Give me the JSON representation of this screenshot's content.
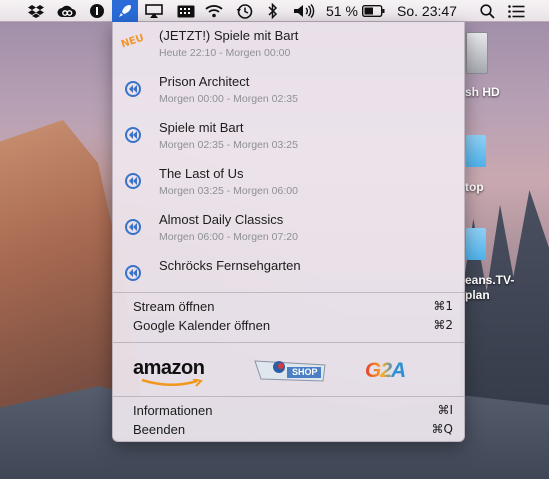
{
  "menubar": {
    "battery_percent": "51 %",
    "clock": "So. 23:47",
    "icons": [
      "dropbox-icon",
      "creative-cloud-icon",
      "info-circle-icon",
      "rocket-app-icon",
      "airplay-icon",
      "keyboard-icon",
      "wifi-icon",
      "time-machine-icon",
      "bluetooth-icon",
      "volume-icon",
      "battery-icon",
      "spotlight-search-icon",
      "notification-center-icon"
    ]
  },
  "desktop": {
    "disk_label": "sh HD",
    "folder1_label": "top",
    "folder2_label_line1": "eans.TV-",
    "folder2_label_line2": "plan"
  },
  "menu": {
    "badge_new": "NEU",
    "entries": [
      {
        "title": "(JETZT!) Spiele mit Bart",
        "time": "Heute 22:10 - Morgen 00:00"
      },
      {
        "title": "Prison Architect",
        "time": "Morgen 00:00 - Morgen 02:35"
      },
      {
        "title": "Spiele mit Bart",
        "time": "Morgen 02:35 - Morgen 03:25"
      },
      {
        "title": "The Last of Us",
        "time": "Morgen 03:25 - Morgen 06:00"
      },
      {
        "title": "Almost Daily Classics",
        "time": "Morgen 06:00 - Morgen 07:20"
      },
      {
        "title": "Schröcks Fernsehgarten",
        "time": ""
      }
    ],
    "stream_label": "Stream öffnen",
    "stream_key": "⌘1",
    "calendar_label": "Google Kalender öffnen",
    "calendar_key": "⌘2",
    "amazon_label": "amazon",
    "shop_label": "SHOP",
    "g2a_label": "G2A",
    "info_label": "Informationen",
    "info_key": "⌘I",
    "quit_label": "Beenden",
    "quit_key": "⌘Q"
  },
  "colors": {
    "accent": "#2a6bd8",
    "entry_icon": "#3a72c9",
    "badge": "#f2962a"
  }
}
